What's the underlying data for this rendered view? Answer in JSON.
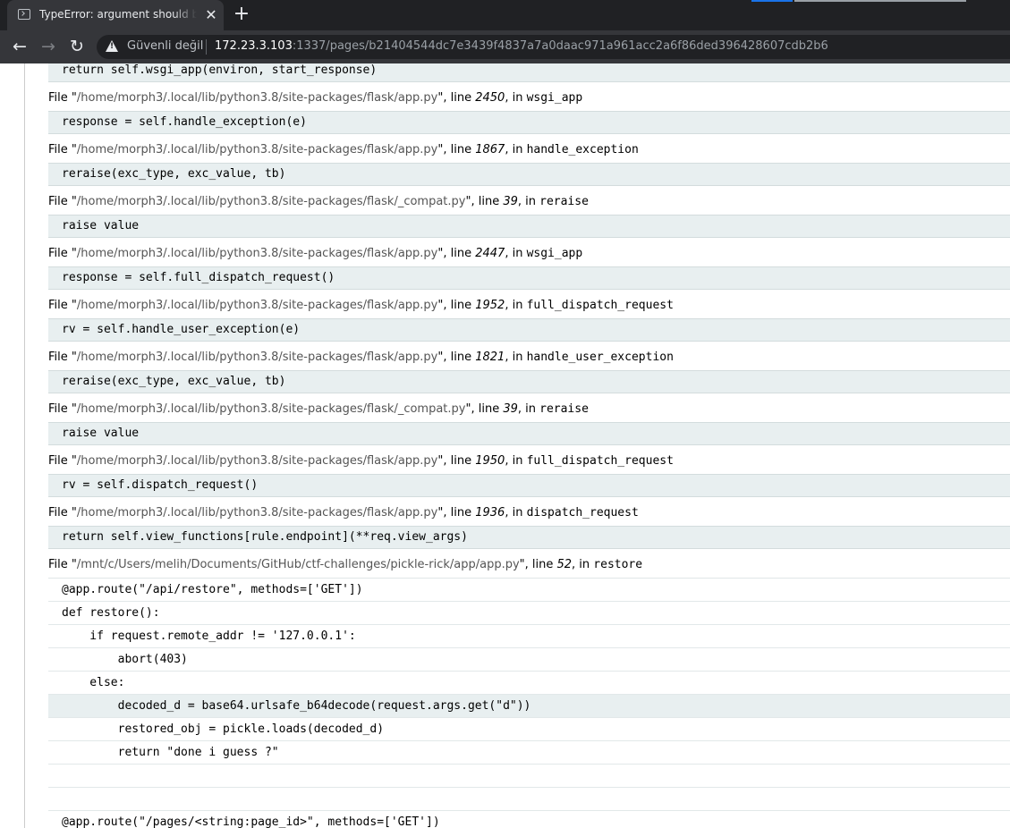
{
  "browser": {
    "tab_title": "TypeError: argument should be a bytes-like object or ASCII string, not 'NoneType'",
    "tab_close": "✕",
    "new_tab": "+",
    "back": "←",
    "forward": "→",
    "reload": "↻",
    "security_label": "Güvenli değil",
    "url_host": "172.23.3.103",
    "url_rest": ":1337/pages/b21404544dc7e3439f4837a7a0daac971a961acc2a6f86ded396428607cdb2b6"
  },
  "traceback": {
    "first_line": "return self.wsgi_app(environ, start_response)",
    "frames": [
      {
        "file": "/home/morph3/.local/lib/python3.8/site-packages/flask/app.py",
        "line": "2450",
        "func": "wsgi_app",
        "code": "response = self.handle_exception(e)"
      },
      {
        "file": "/home/morph3/.local/lib/python3.8/site-packages/flask/app.py",
        "line": "1867",
        "func": "handle_exception",
        "code": "reraise(exc_type, exc_value, tb)"
      },
      {
        "file": "/home/morph3/.local/lib/python3.8/site-packages/flask/_compat.py",
        "line": "39",
        "func": "reraise",
        "code": "raise value"
      },
      {
        "file": "/home/morph3/.local/lib/python3.8/site-packages/flask/app.py",
        "line": "2447",
        "func": "wsgi_app",
        "code": "response = self.full_dispatch_request()"
      },
      {
        "file": "/home/morph3/.local/lib/python3.8/site-packages/flask/app.py",
        "line": "1952",
        "func": "full_dispatch_request",
        "code": "rv = self.handle_user_exception(e)"
      },
      {
        "file": "/home/morph3/.local/lib/python3.8/site-packages/flask/app.py",
        "line": "1821",
        "func": "handle_user_exception",
        "code": "reraise(exc_type, exc_value, tb)"
      },
      {
        "file": "/home/morph3/.local/lib/python3.8/site-packages/flask/_compat.py",
        "line": "39",
        "func": "reraise",
        "code": "raise value"
      },
      {
        "file": "/home/morph3/.local/lib/python3.8/site-packages/flask/app.py",
        "line": "1950",
        "func": "full_dispatch_request",
        "code": "rv = self.dispatch_request()"
      },
      {
        "file": "/home/morph3/.local/lib/python3.8/site-packages/flask/app.py",
        "line": "1936",
        "func": "dispatch_request",
        "code": "return self.view_functions[rule.endpoint](**req.view_args)"
      }
    ],
    "last_frame": {
      "file": "/mnt/c/Users/melih/Documents/GitHub/ctf-challenges/pickle-rick/app/app.py",
      "line": "52",
      "func": "restore",
      "source": [
        {
          "text": "@app.route(\"/api/restore\", methods=['GET'])",
          "current": false
        },
        {
          "text": "def restore():",
          "current": false
        },
        {
          "text": "    if request.remote_addr != '127.0.0.1':",
          "current": false
        },
        {
          "text": "        abort(403)",
          "current": false
        },
        {
          "text": "    else:",
          "current": false
        },
        {
          "text": "        decoded_d = base64.urlsafe_b64decode(request.args.get(\"d\"))",
          "current": true
        },
        {
          "text": "        restored_obj = pickle.loads(decoded_d)",
          "current": false
        },
        {
          "text": "        return \"done i guess ?\"",
          "current": false
        },
        {
          "text": "",
          "current": false
        },
        {
          "text": "",
          "current": false
        },
        {
          "text": "@app.route(\"/pages/<string:page_id>\", methods=['GET'])",
          "current": false
        }
      ]
    },
    "labels": {
      "file_prefix": "File \"",
      "line_sep": "\", line ",
      "in_sep": ", in "
    }
  }
}
